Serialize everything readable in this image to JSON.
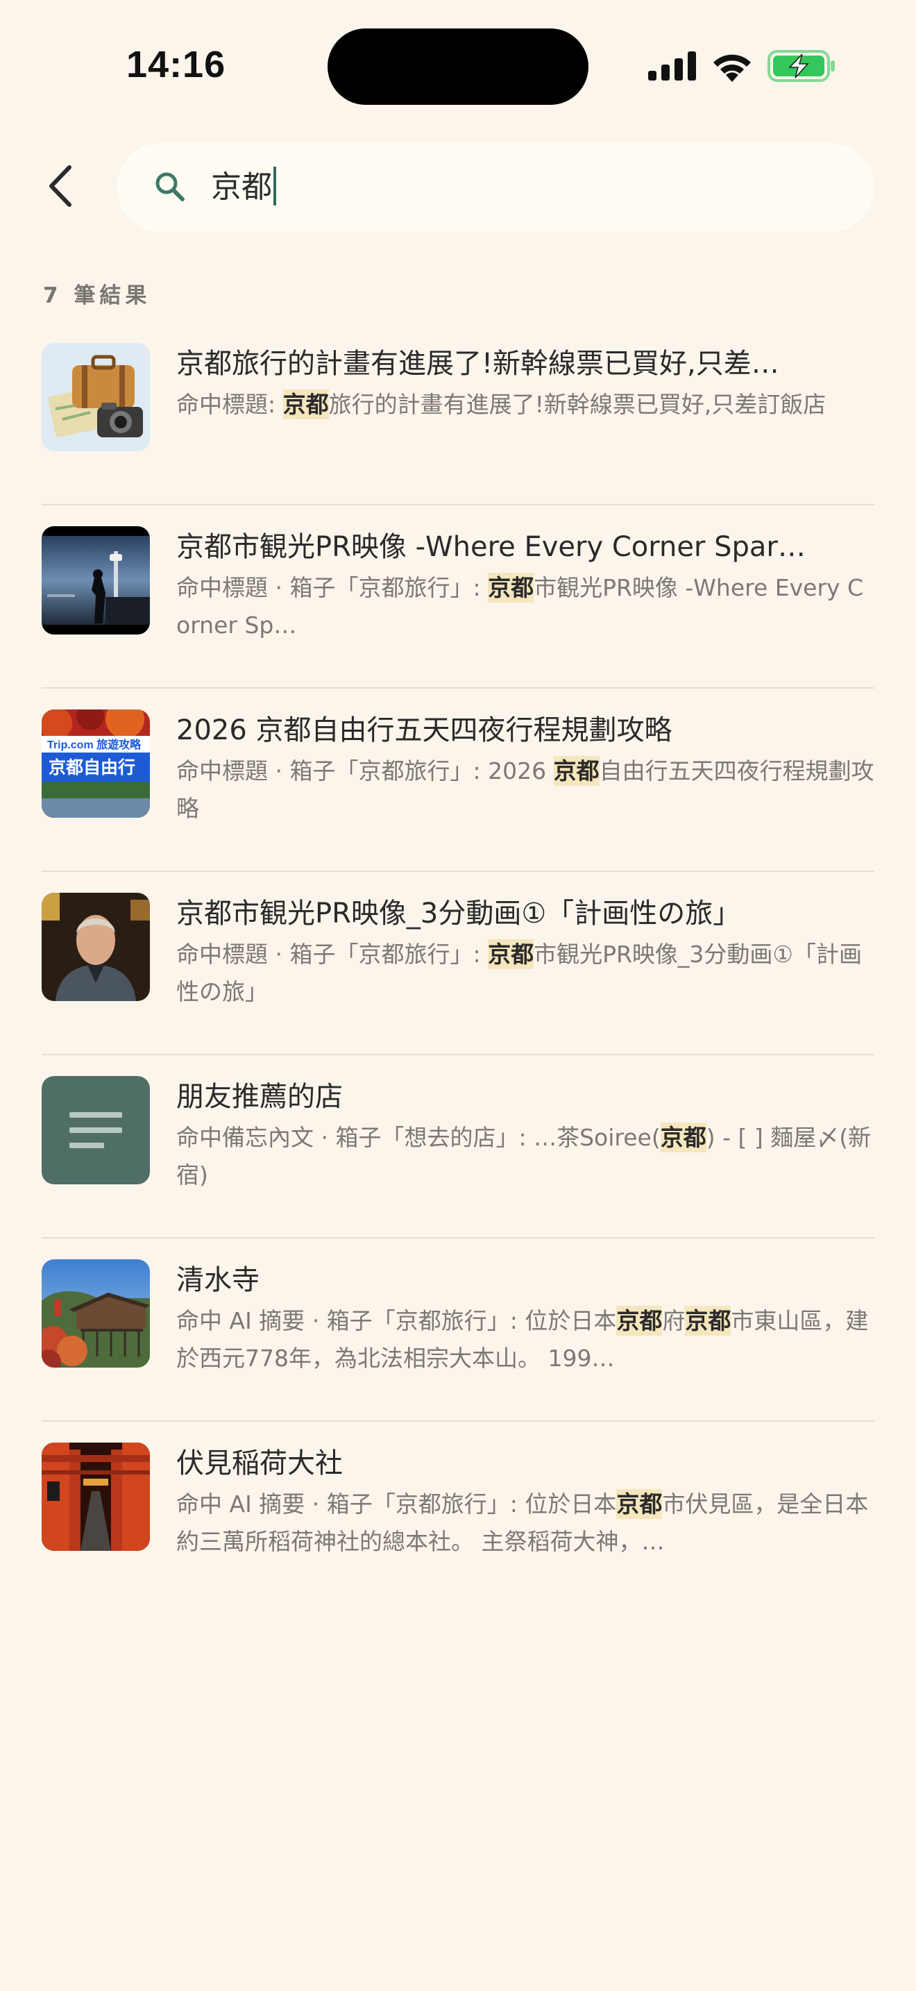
{
  "status_bar": {
    "time": "14:16"
  },
  "search": {
    "query": "京都"
  },
  "results_count_label": "7 筆結果",
  "results": [
    {
      "thumb_icon": "luggage-camera-map-icon",
      "title": "京都旅行的計畫有進展了!新幹線票已買好,只差…",
      "snippet": [
        {
          "t": "命中標題: ",
          "h": false
        },
        {
          "t": "京都",
          "h": true
        },
        {
          "t": "旅行的計畫有進展了!新幹線票已買好,只差訂飯店",
          "h": false
        }
      ]
    },
    {
      "thumb_icon": "kyoto-tower-photo",
      "title": "京都市観光PR映像 -Where Every Corner Spar…",
      "snippet": [
        {
          "t": "命中標題 · 箱子「京都旅行」: ",
          "h": false
        },
        {
          "t": "京都",
          "h": true
        },
        {
          "t": "市観光PR映像 -Where Every Corner Sp…",
          "h": false
        }
      ]
    },
    {
      "thumb_icon": "trip-com-banner",
      "thumb_text": {
        "brand": "Trip.com 旅遊攻略",
        "banner": "京都自由行"
      },
      "title": "2026 京都自由行五天四夜行程規劃攻略",
      "snippet": [
        {
          "t": "命中標題 · 箱子「京都旅行」: 2026 ",
          "h": false
        },
        {
          "t": "京都",
          "h": true
        },
        {
          "t": "自由行五天四夜行程規劃攻略",
          "h": false
        }
      ]
    },
    {
      "thumb_icon": "man-portrait-photo",
      "title": "京都市観光PR映像_3分動画①「計画性の旅」",
      "snippet": [
        {
          "t": "命中標題 · 箱子「京都旅行」: ",
          "h": false
        },
        {
          "t": "京都",
          "h": true
        },
        {
          "t": "市観光PR映像_3分動画①「計画性の旅」",
          "h": false
        }
      ]
    },
    {
      "thumb_icon": "note-lines-icon",
      "title": "朋友推薦的店",
      "snippet": [
        {
          "t": "命中備忘內文 · 箱子「想去的店」: …茶Soiree(",
          "h": false
        },
        {
          "t": "京都",
          "h": true
        },
        {
          "t": ") - [ ] 麵屋〆(新宿)",
          "h": false
        }
      ]
    },
    {
      "thumb_icon": "kiyomizu-temple-photo",
      "title": "清水寺",
      "snippet": [
        {
          "t": "命中 AI 摘要 · 箱子「京都旅行」: 位於日本",
          "h": false
        },
        {
          "t": "京都",
          "h": true
        },
        {
          "t": "府",
          "h": false
        },
        {
          "t": "京都",
          "h": true
        },
        {
          "t": "市東山區，建於西元778年，為北法相宗大本山。 199…",
          "h": false
        }
      ]
    },
    {
      "thumb_icon": "torii-gates-photo",
      "title": "伏見稲荷大社",
      "snippet": [
        {
          "t": "命中 AI 摘要 · 箱子「京都旅行」: 位於日本",
          "h": false
        },
        {
          "t": "京都",
          "h": true
        },
        {
          "t": "市伏見區，是全日本約三萬所稻荷神社的總本社。 主祭稻荷大神，…",
          "h": false
        }
      ]
    }
  ]
}
